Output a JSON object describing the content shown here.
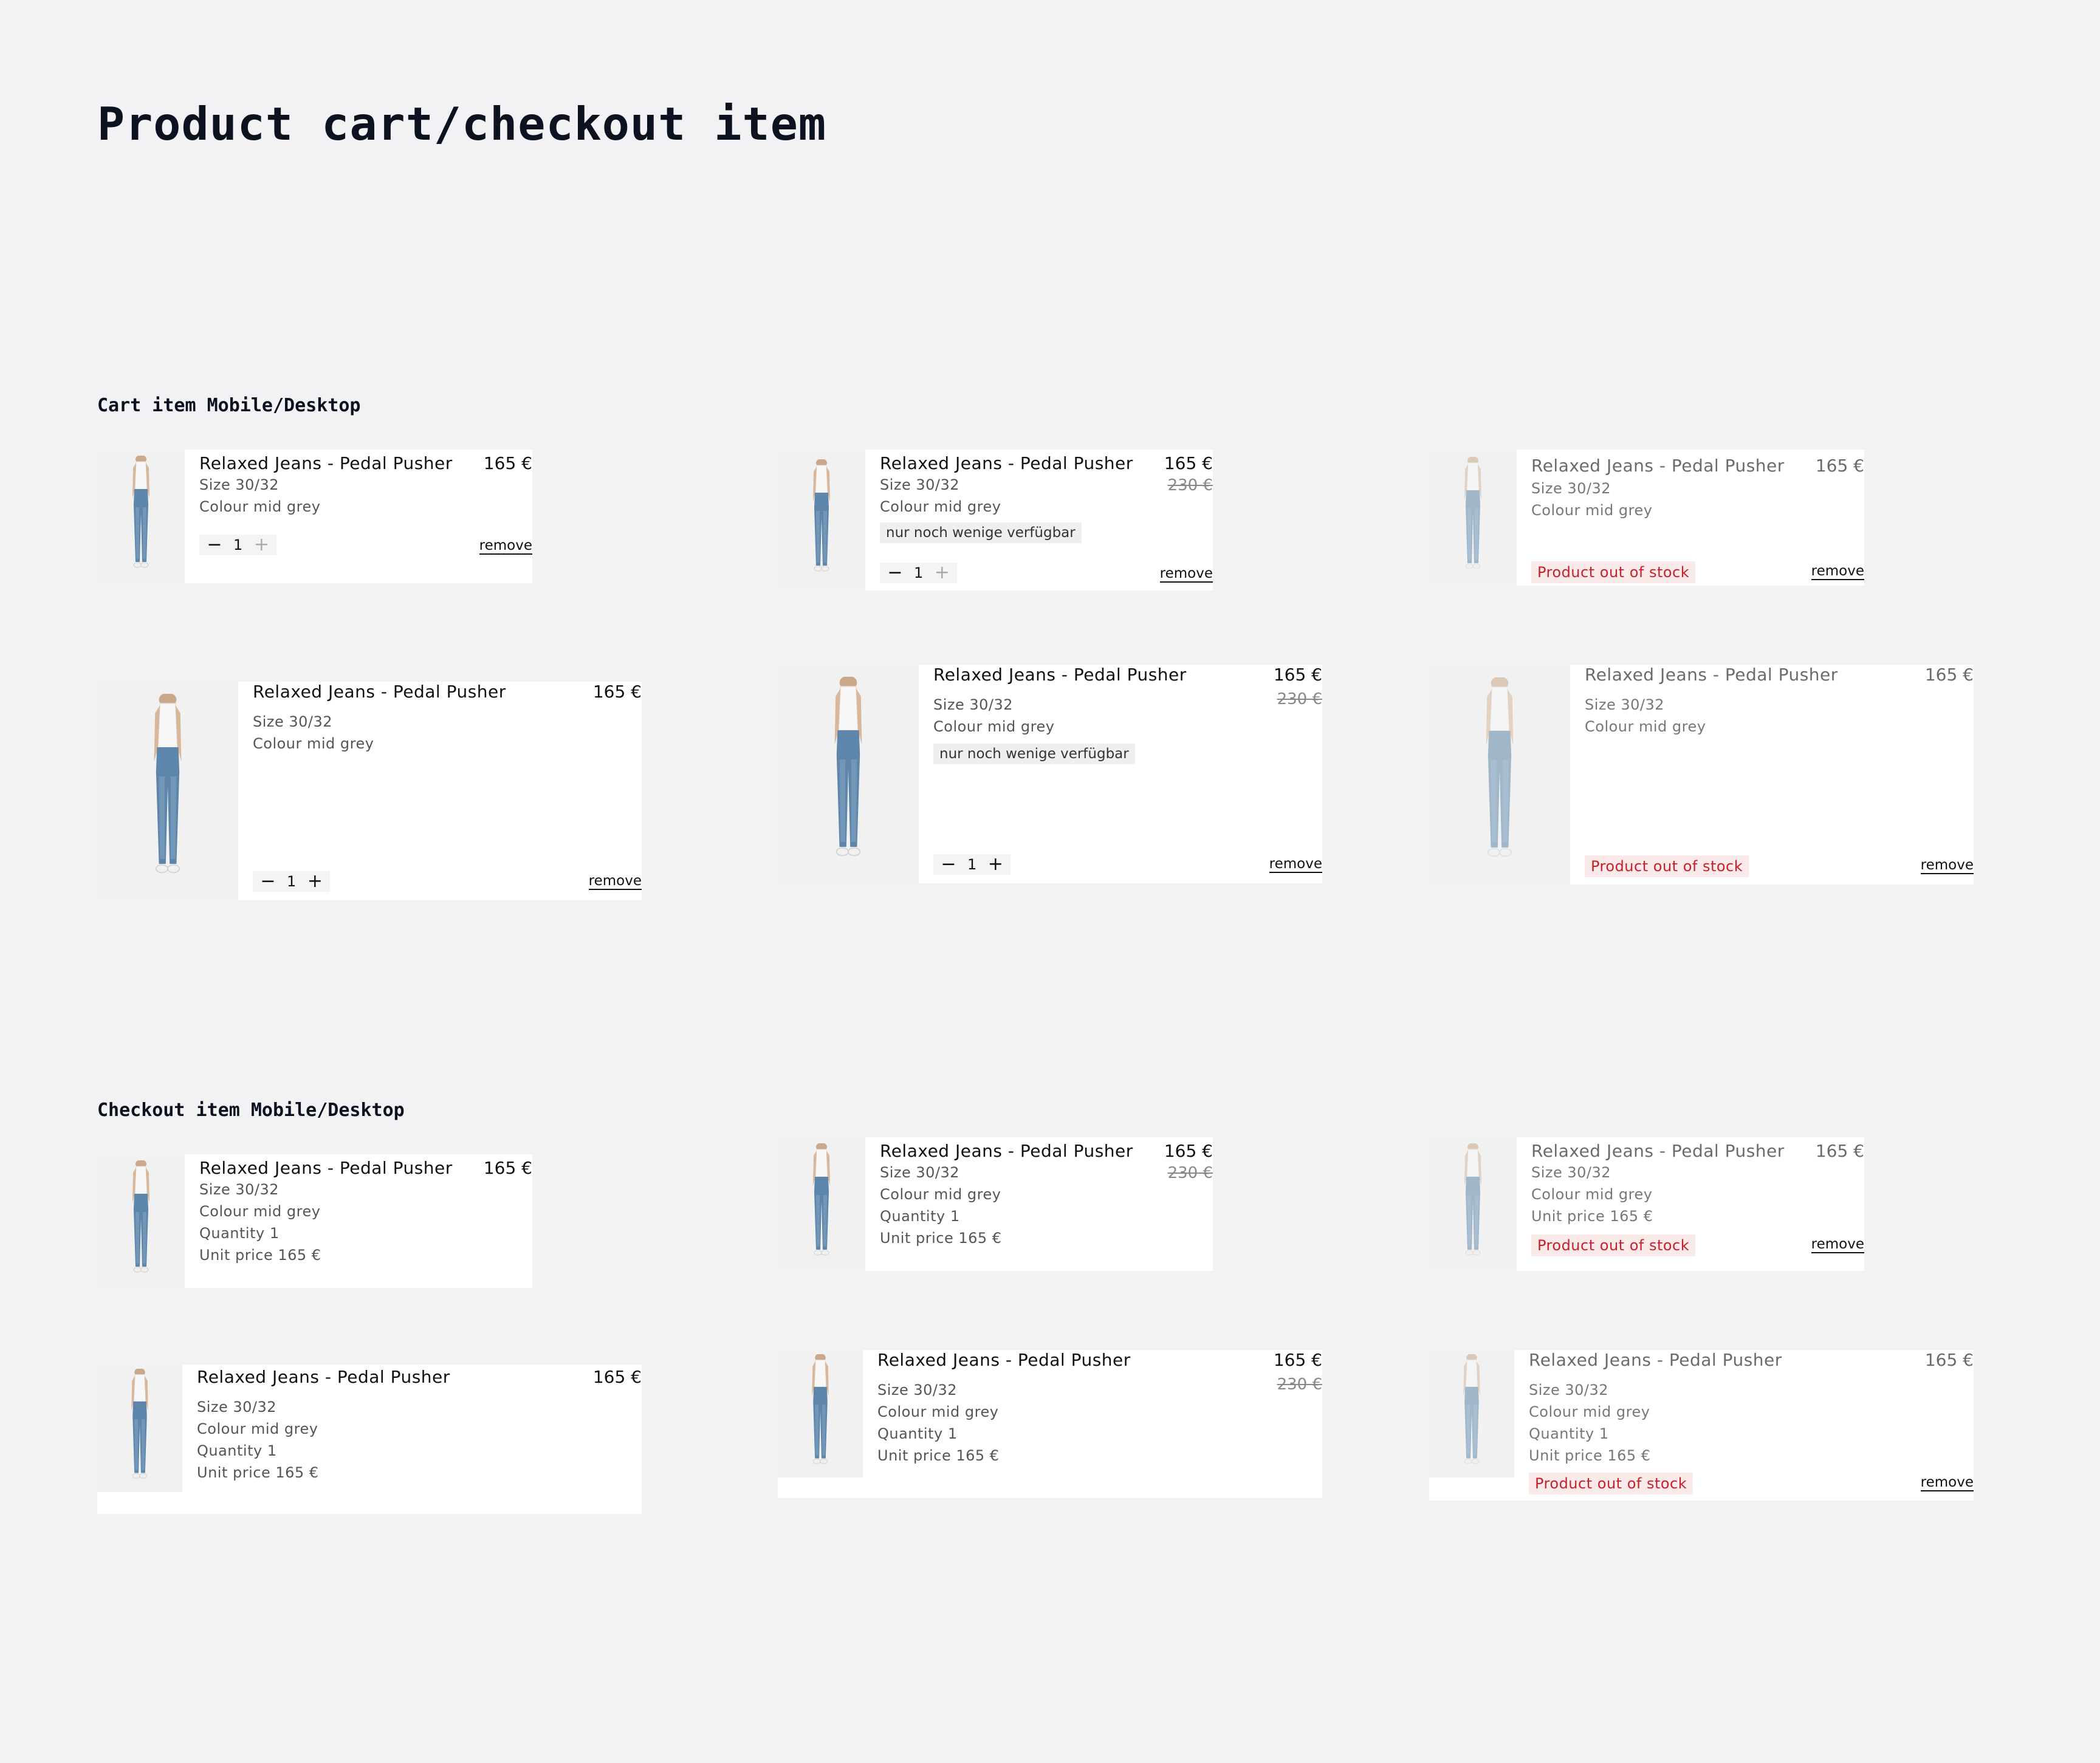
{
  "page": {
    "title": "Product cart/checkout item"
  },
  "sections": {
    "cart": {
      "label": "Cart item Mobile/Desktop"
    },
    "checkout": {
      "label": "Checkout item Mobile/Desktop"
    }
  },
  "product": {
    "name": "Relaxed Jeans - Pedal Pusher",
    "price": "165 €",
    "old_price": "230 €",
    "size": "Size 30/32",
    "colour": "Colour mid grey",
    "quantity_line": "Quantity  1",
    "unit_price_line": "Unit price  165 €",
    "unit_price_line_compact": "Unit price 165 €",
    "quantity_value": "1",
    "low_stock": "nur noch wenige verfügbar",
    "out_of_stock": "Product out of stock",
    "remove": "remove",
    "image_icon": "jeans-product-photo"
  },
  "colors": {
    "background": "#f2f2f5",
    "out_of_stock": "#c8202a",
    "low_stock_bg": "#efefef"
  }
}
